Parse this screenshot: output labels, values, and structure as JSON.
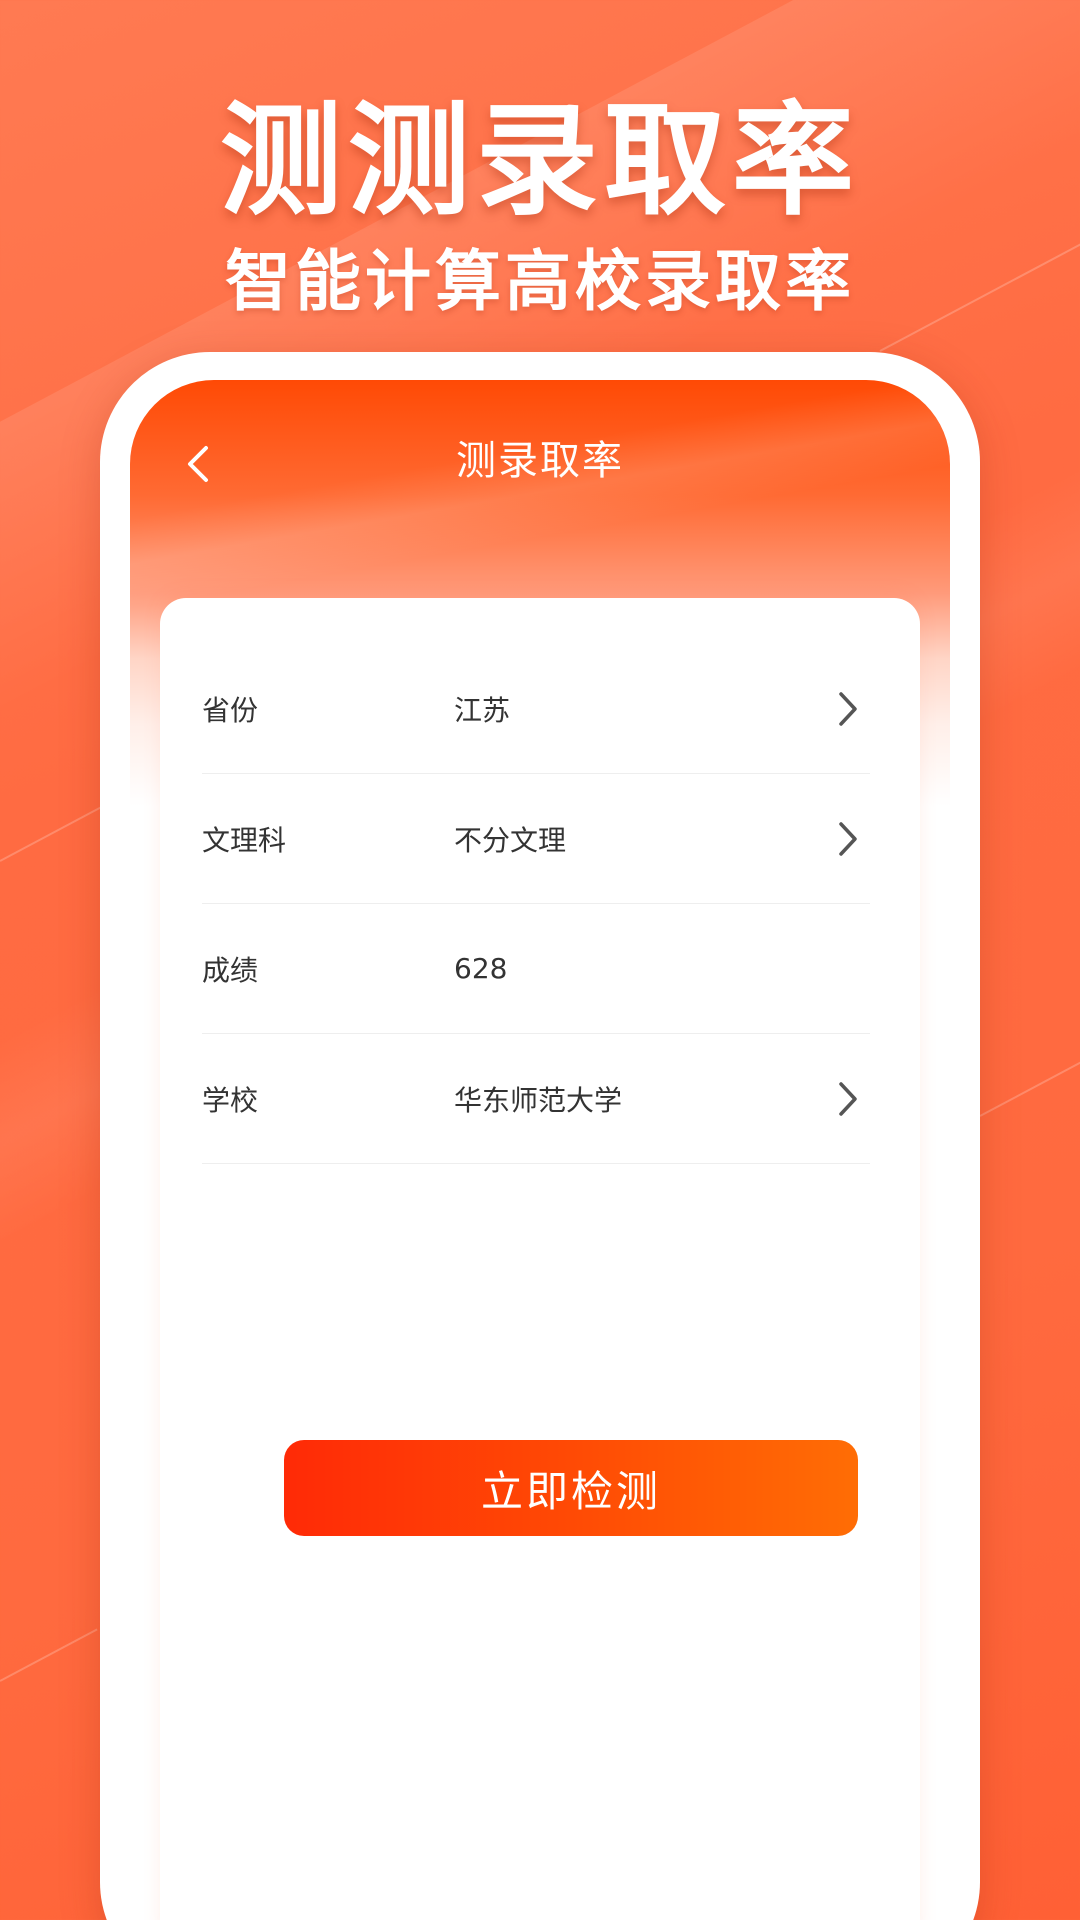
{
  "hero": {
    "title": "测测录取率",
    "subtitle": "智能计算高校录取率"
  },
  "screen": {
    "title": "测录取率",
    "back_icon": "chevron-left-icon"
  },
  "form": {
    "rows": [
      {
        "label": "省份",
        "value": "江苏",
        "has_chevron": true
      },
      {
        "label": "文理科",
        "value": "不分文理",
        "has_chevron": true
      },
      {
        "label": "成绩",
        "value": "628",
        "has_chevron": false
      },
      {
        "label": "学校",
        "value": "华东师范大学",
        "has_chevron": true
      }
    ],
    "submit_label": "立即检测"
  },
  "colors": {
    "background": "#ff6b42",
    "accent_start": "#ff2a06",
    "accent_end": "#ff6d05",
    "header_top": "#ff4a05",
    "text_primary": "#333333"
  }
}
